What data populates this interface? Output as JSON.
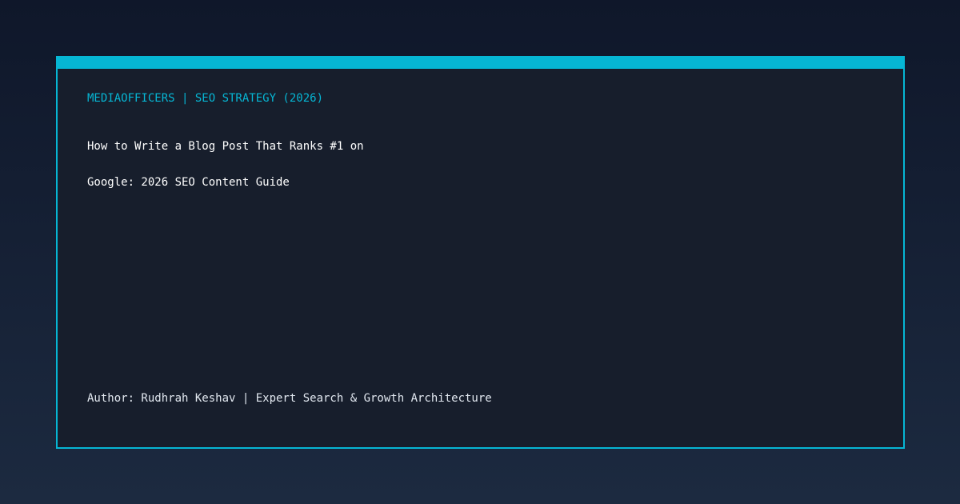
{
  "card": {
    "kicker": "MEDIAOFFICERS | SEO STRATEGY (2026)",
    "title_lines": [
      "How to Write a Blog Post That Ranks #1 on",
      "Google: 2026 SEO Content Guide"
    ],
    "byline": "Author: Rudhrah Keshav | Expert Search & Growth Architecture"
  },
  "colors": {
    "accent": "#06b6d4",
    "background_top": "#0f172a",
    "background_bottom": "#1c2a40",
    "card_background": "#171e2c",
    "title_text": "#ffffff"
  }
}
